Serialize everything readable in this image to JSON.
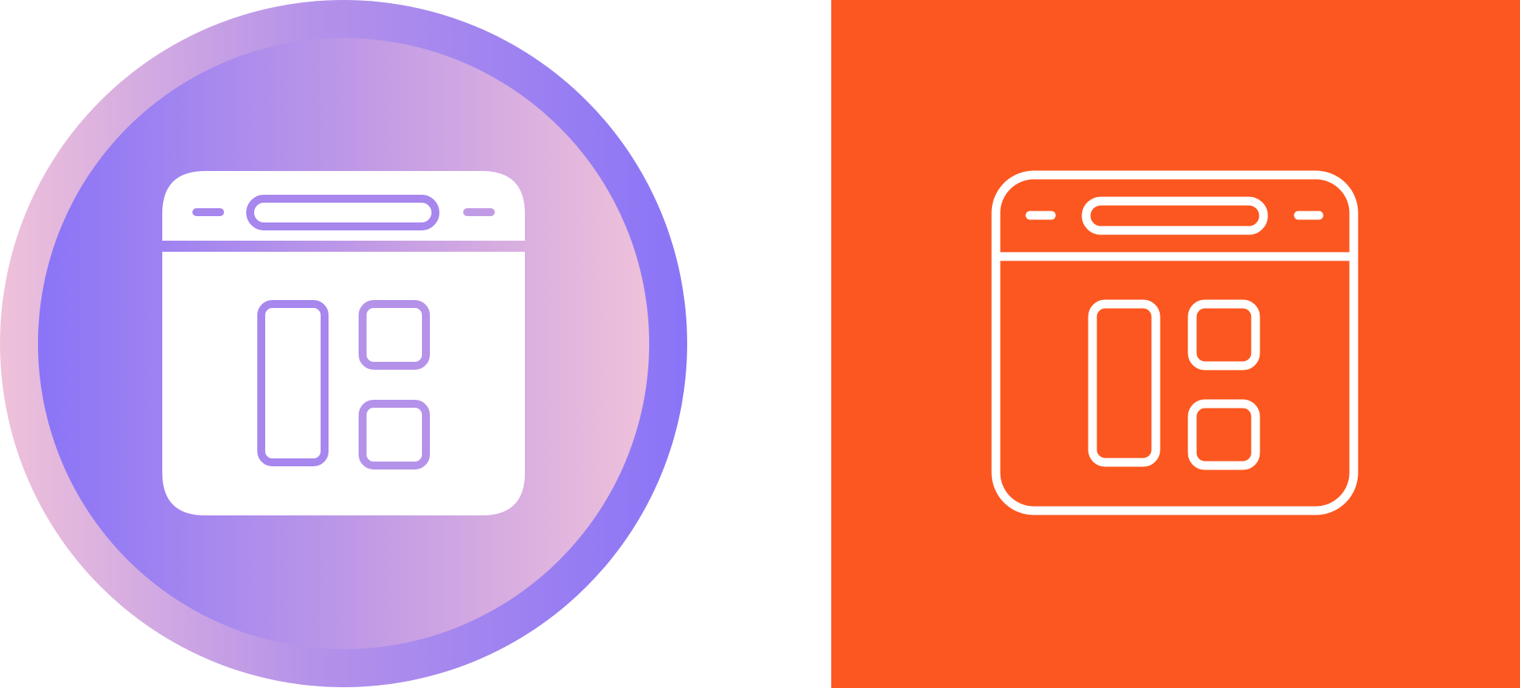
{
  "colors": {
    "page_background": "#ffffff",
    "accent_purple": "#8a74f7",
    "accent_pink": "#efc1da",
    "lilac": "#c29be6",
    "glyph_white": "#ffffff",
    "orange_background": "#fc5720",
    "orange_stroke": "#ffffff"
  },
  "icons": {
    "left": "browser-layout-glyph-icon",
    "right": "browser-layout-outline-icon"
  }
}
